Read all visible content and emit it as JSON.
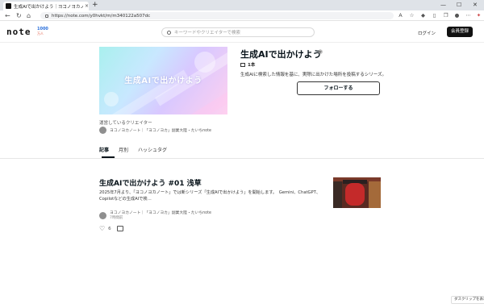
{
  "browser": {
    "tab_title": "生成AIで出かけよう｜ヨコノヨカノート",
    "tab_close": "×",
    "new_tab": "+",
    "minimize": "—",
    "maximize": "☐",
    "close": "✕",
    "url": "https://note.com/y0hvkt/m/m340122a507dc"
  },
  "header": {
    "logo_text": "note",
    "logo_badge_top": "1000",
    "logo_badge_bottom": "万人",
    "search_placeholder": "キーワードやクリエイターで検索",
    "login_label": "ログイン",
    "signup_label": "会員登録"
  },
  "magazine": {
    "cover_text": "生成AIで出かけよう",
    "title": "生成AIで出かけよう",
    "article_count": "1本",
    "description": "生成AIに検索した情報を基に、実際に出かけた場所を投稿するシリーズ。",
    "follow_label": "フォローする",
    "operator_label": "運営しているクリエイター",
    "operator_name": "ヨコノヨカノート｜「ヨコノヨカ」副業大陸・たいちnote"
  },
  "tabs": [
    {
      "label": "記事",
      "active": true
    },
    {
      "label": "月別",
      "active": false
    },
    {
      "label": "ハッシュタグ",
      "active": false
    }
  ],
  "article": {
    "title": "生成AIで出かけよう #01 浅草",
    "excerpt": "2025年7月より、「ヨコノヨカノート」では新シリーズ「生成AIで出かけよう」を開始します。　Gemini、ChatGPT、Copilotなどの生成AIで検…",
    "author": "ヨコノヨカノート｜「ヨコノヨカ」副業大陸・たいちnote",
    "time": "7時間前",
    "likes": "6"
  },
  "footer_chip": "ダスクリップを表示"
}
